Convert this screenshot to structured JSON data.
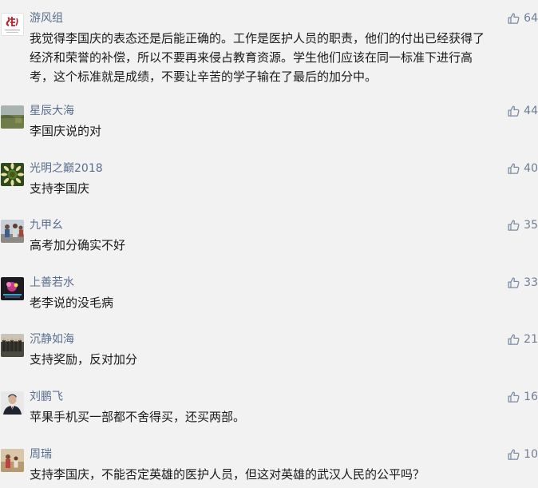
{
  "comments": [
    {
      "author": "游风组",
      "likes": "64",
      "lines": [
        "我觉得李国庆的表态还是后能正确的。工作是医护人员的职责，他们的付出已经获得了",
        "经济和荣誉的补偿，所以不要再来侵占教育资源。学生他们应该在同一标准下进行高",
        "考，这个标准就是成绩，不要让辛苦的学子输在了最后的加分中。"
      ]
    },
    {
      "author": "星辰大海",
      "likes": "44",
      "lines": [
        "李国庆说的对"
      ]
    },
    {
      "author": "光明之巅2018",
      "likes": "40",
      "lines": [
        "支持李国庆"
      ]
    },
    {
      "author": "九甲幺",
      "likes": "35",
      "lines": [
        "高考加分确实不好"
      ]
    },
    {
      "author": "上善若水",
      "likes": "33",
      "lines": [
        "老李说的没毛病"
      ]
    },
    {
      "author": "沉静如海",
      "likes": "21",
      "lines": [
        "支持奖励，反对加分"
      ]
    },
    {
      "author": "刘鹏飞",
      "likes": "16",
      "lines": [
        "苹果手机买一部都不舍得买，还买两部。"
      ]
    },
    {
      "author": "周瑞",
      "likes": "10",
      "lines": [
        "支持李国庆，不能否定英雄的医护人员，但这对英雄的武汉人民的公平吗？"
      ]
    }
  ],
  "icons": {
    "like": "thumbs-up-icon"
  },
  "colors": {
    "background": "#f2f2f2",
    "author": "#5a6f8e",
    "like_icon": "#7b8aa3"
  }
}
